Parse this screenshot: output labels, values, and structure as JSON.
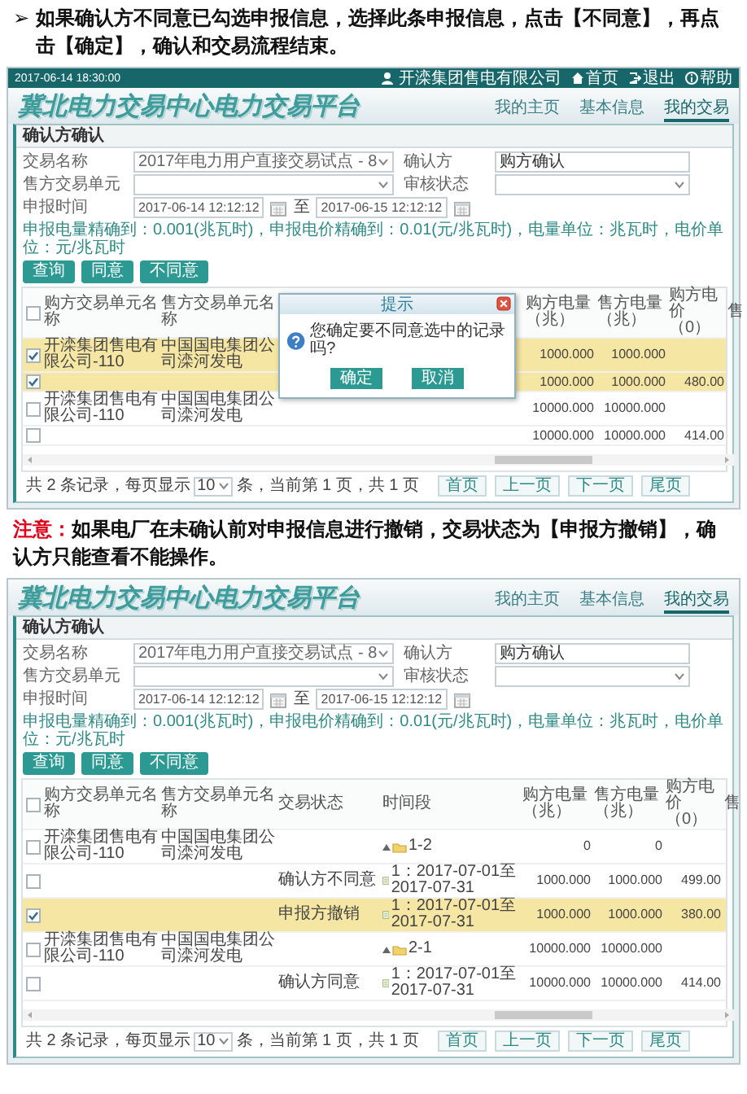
{
  "sections": [
    {
      "kind": "bullet",
      "marker": "➢",
      "text": "如果确认方不同意已勾选申报信息，选择此条申报信息，点击【不同意】，再点击【确定】，确认和交易流程结束。"
    },
    {
      "kind": "screen",
      "top_bar": {
        "datetime": "2017-06-14 18:30:00",
        "user": "开滦集团售电有限公司",
        "links": [
          {
            "kind": "home",
            "label": "首页"
          },
          {
            "kind": "logout",
            "label": "退出"
          },
          {
            "kind": "help",
            "label": "帮助"
          }
        ]
      },
      "app_title": "冀北电力交易中心电力交易平台",
      "nav": [
        {
          "label": "我的主页",
          "selected": false
        },
        {
          "label": "基本信息",
          "selected": false
        },
        {
          "label": "我的交易",
          "selected": true
        }
      ],
      "panel_title": "确认方确认",
      "form": {
        "fields": [
          {
            "label": "交易名称",
            "kind": "select",
            "value": "2017年电力用户直接交易试点 - 8"
          },
          {
            "label": "确认方",
            "kind": "input",
            "value": "购方确认"
          },
          {
            "label": "售方交易单元",
            "kind": "select"
          },
          {
            "label": "审核状态",
            "kind": "select"
          }
        ],
        "time": {
          "label": "申报时间",
          "from": "2017-06-14 12:12:12",
          "separator": "至",
          "to": "2017-06-15 12:12:12"
        }
      },
      "hint": "申报电量精确到：0.001(兆瓦时)，申报电价精确到：0.01(元/兆瓦时)，电量单位：兆瓦时，电价单位：元/兆瓦时",
      "actions": [
        "查询",
        "同意",
        "不同意"
      ],
      "table": {
        "select_all": {
          "checked": false
        },
        "columns": [
          "购方交易单元名称",
          "售方交易单元名称",
          "购方电量（兆）",
          "售方电量（兆）",
          "购方电价（0）",
          "售"
        ],
        "rows": [
          {
            "checked": true,
            "selected": true,
            "buyer": "开滦集团售电有限公司-110",
            "seller": "中国国电集团公司滦河发电",
            "buy_qty": "1000.000",
            "sell_qty": "1000.000"
          },
          {
            "checked": true,
            "selected": true,
            "buy_qty": "1000.000",
            "sell_qty": "1000.000",
            "buy_price": "480.00"
          },
          {
            "checked": false,
            "selected": false,
            "buyer": "开滦集团售电有限公司-110",
            "seller": "中国国电集团公司滦河发电",
            "buy_qty": "10000.000",
            "sell_qty": "10000.000"
          },
          {
            "checked": false,
            "selected": false,
            "buy_qty": "10000.000",
            "sell_qty": "10000.000",
            "buy_price": "414.00"
          }
        ]
      },
      "pager": {
        "before": "共 2 条记录，每页显示",
        "page_size": "10",
        "after": "条，当前第 1 页，共 1 页",
        "buttons": [
          "首页",
          "上一页",
          "下一页",
          "尾页"
        ]
      },
      "dialog": {
        "title": "提示",
        "message": "您确定要不同意选中的记录吗?",
        "buttons": [
          "确定",
          "取消"
        ]
      }
    },
    {
      "kind": "note",
      "label": "注意：",
      "text": "如果电厂在未确认前对申报信息进行撤销，交易状态为【申报方撤销】，确认方只能查看不能操作。"
    },
    {
      "kind": "screen",
      "app_title": "冀北电力交易中心电力交易平台",
      "nav": [
        {
          "label": "我的主页",
          "selected": false
        },
        {
          "label": "基本信息",
          "selected": false
        },
        {
          "label": "我的交易",
          "selected": true
        }
      ],
      "panel_title": "确认方确认",
      "form": {
        "fields": [
          {
            "label": "交易名称",
            "kind": "select",
            "value": "2017年电力用户直接交易试点 - 8"
          },
          {
            "label": "确认方",
            "kind": "input",
            "value": "购方确认"
          },
          {
            "label": "售方交易单元",
            "kind": "select"
          },
          {
            "label": "审核状态",
            "kind": "select"
          }
        ],
        "time": {
          "label": "申报时间",
          "from": "2017-06-14 12:12:12",
          "separator": "至",
          "to": "2017-06-15 12:12:12"
        }
      },
      "hint": "申报电量精确到：0.001(兆瓦时)，申报电价精确到：0.01(元/兆瓦时)，电量单位：兆瓦时，电价单位：元/兆瓦时",
      "actions": [
        "查询",
        "同意",
        "不同意"
      ],
      "table": {
        "select_all": {
          "checked": false
        },
        "columns": [
          "购方交易单元名称",
          "售方交易单元名称",
          "交易状态",
          "时间段",
          "购方电量（兆）",
          "售方电量（兆）",
          "购方电价（0）",
          "售"
        ],
        "rows": [
          {
            "kind": "group",
            "checked": false,
            "selected": false,
            "buyer": "开滦集团售电有限公司-110",
            "seller": "中国国电集团公司滦河发电",
            "period": "1-2",
            "buy_qty": "0",
            "sell_qty": "0"
          },
          {
            "kind": "item",
            "checked": false,
            "selected": false,
            "state": "确认方不同意",
            "period": "1：2017-07-01至2017-07-31",
            "buy_qty": "1000.000",
            "sell_qty": "1000.000",
            "buy_price": "499.00"
          },
          {
            "kind": "item",
            "checked": true,
            "selected": true,
            "state": "申报方撤销",
            "period": "1：2017-07-01至2017-07-31",
            "buy_qty": "1000.000",
            "sell_qty": "1000.000",
            "buy_price": "380.00"
          },
          {
            "kind": "group",
            "checked": false,
            "selected": false,
            "buyer": "开滦集团售电有限公司-110",
            "seller": "中国国电集团公司滦河发电",
            "period": "2-1",
            "buy_qty": "10000.000",
            "sell_qty": "10000.000"
          },
          {
            "kind": "item",
            "checked": false,
            "selected": false,
            "state": "确认方同意",
            "period": "1：2017-07-01至2017-07-31",
            "buy_qty": "10000.000",
            "sell_qty": "10000.000",
            "buy_price": "414.00"
          }
        ]
      },
      "pager": {
        "before": "共 2 条记录，每页显示",
        "page_size": "10",
        "after": "条，当前第 1 页，共 1 页",
        "buttons": [
          "首页",
          "上一页",
          "下一页",
          "尾页"
        ]
      }
    }
  ]
}
